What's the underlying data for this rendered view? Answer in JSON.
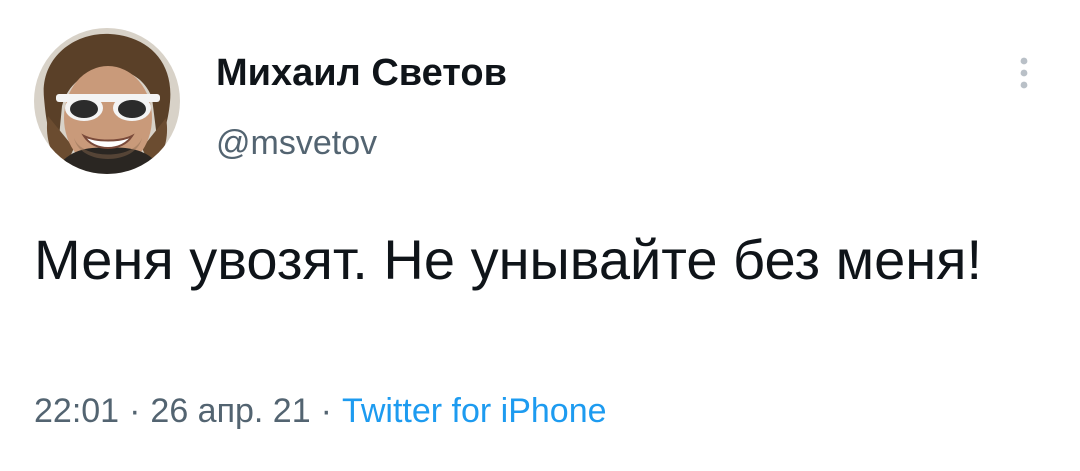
{
  "author": {
    "display_name": "Михаил Светов",
    "handle": "@msvetov",
    "avatar_icon": "profile-photo-person-sunglasses"
  },
  "more_icon": "more-vertical-icon",
  "tweet": {
    "text": "Меня увозят. Не унывайте без меня!",
    "time": "22:01",
    "date": "26 апр. 21",
    "separator": "·",
    "source": "Twitter for iPhone"
  },
  "colors": {
    "text_primary": "#0f1419",
    "text_secondary": "#536471",
    "link": "#1d9bf0",
    "background": "#ffffff"
  }
}
